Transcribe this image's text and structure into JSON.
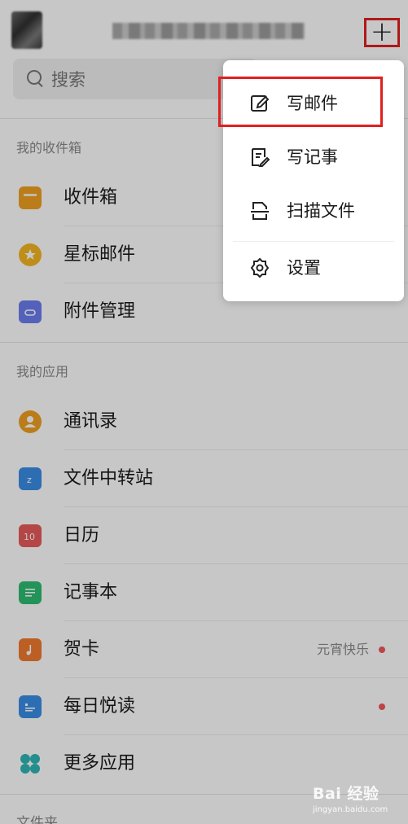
{
  "search": {
    "placeholder": "搜索"
  },
  "header": {
    "plus_symbol": "+"
  },
  "sections": {
    "inbox": "我的收件箱",
    "apps": "我的应用",
    "folders": "文件夹"
  },
  "inbox_items": [
    {
      "label": "收件箱",
      "icon": "inbox-icon",
      "color": "#f0a020"
    },
    {
      "label": "星标邮件",
      "icon": "star-icon",
      "color": "#f5b521"
    },
    {
      "label": "附件管理",
      "icon": "attachment-icon",
      "color": "#6c7df0"
    }
  ],
  "app_items": [
    {
      "label": "通讯录",
      "icon": "contacts-icon",
      "color": "#f0a020"
    },
    {
      "label": "文件中转站",
      "icon": "file-transfer-icon",
      "color": "#3a8ee6"
    },
    {
      "label": "日历",
      "icon": "calendar-icon",
      "color": "#e85a5a",
      "icon_text": "10"
    },
    {
      "label": "记事本",
      "icon": "notebook-icon",
      "color": "#2ebd72"
    },
    {
      "label": "贺卡",
      "icon": "card-icon",
      "color": "#f07a30",
      "side": "元宵快乐",
      "dot": true
    },
    {
      "label": "每日悦读",
      "icon": "reading-icon",
      "color": "#3a8ee6",
      "dot": true
    },
    {
      "label": "更多应用",
      "icon": "more-apps-icon",
      "color": "#2fb5b5"
    }
  ],
  "popup": {
    "items": [
      {
        "label": "写邮件",
        "icon": "compose-icon"
      },
      {
        "label": "写记事",
        "icon": "write-note-icon"
      },
      {
        "label": "扫描文件",
        "icon": "scan-icon"
      },
      {
        "label": "设置",
        "icon": "gear-icon"
      }
    ]
  },
  "watermark": {
    "line1": "Bai 经验",
    "line2": "jingyan.baidu.com"
  },
  "colors": {
    "highlight": "#e02020",
    "dot": "#f0585a"
  }
}
